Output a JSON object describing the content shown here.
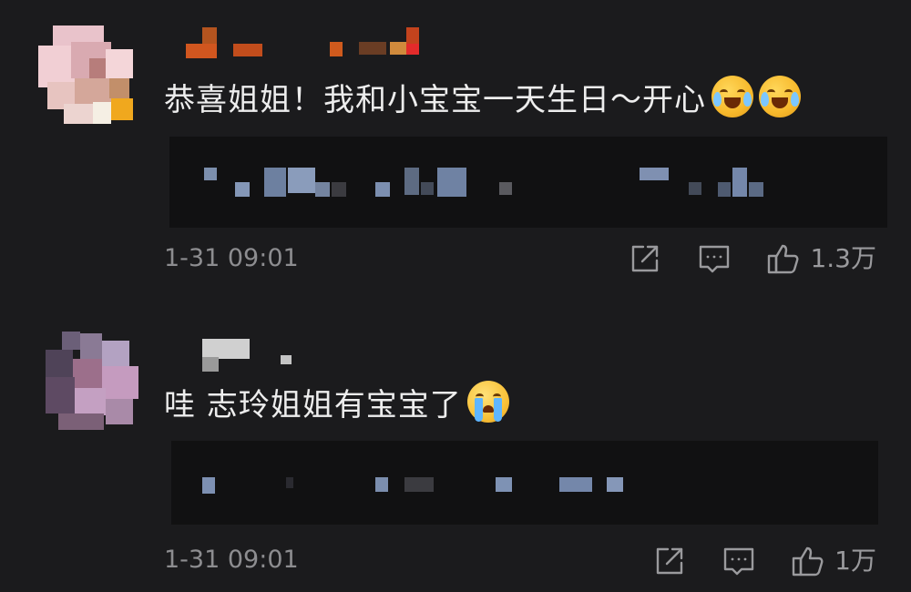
{
  "comments": [
    {
      "text": "恭喜姐姐！我和小宝宝一天生日～开心",
      "emojis": [
        "laughing-crying-icon",
        "laughing-crying-icon"
      ],
      "timestamp": "1-31 09:01",
      "likes": "1.3万"
    },
    {
      "text": "哇 志玲姐姐有宝宝了",
      "emojis": [
        "loudly-crying-icon"
      ],
      "timestamp": "1-31 09:01",
      "likes": "1万"
    }
  ],
  "icons": {
    "share": "share-icon",
    "reply": "comment-icon",
    "like": "thumbs-up-icon"
  },
  "colors": {
    "background": "#1b1b1d",
    "text": "#ededed",
    "muted": "#8d8d90",
    "reply_box": "#111112"
  }
}
